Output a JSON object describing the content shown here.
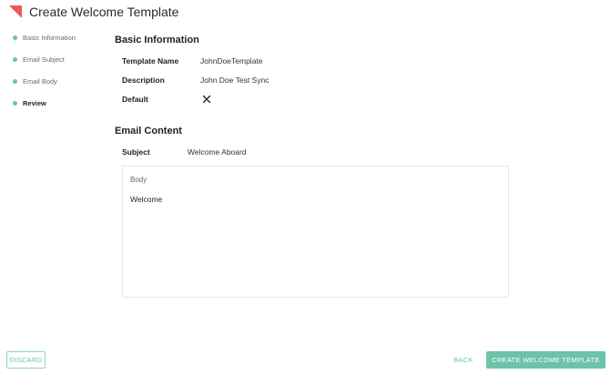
{
  "header": {
    "title": "Create Welcome Template",
    "logo_color": "#e8585e"
  },
  "stepper": {
    "items": [
      {
        "label": "Basic Information",
        "active": false
      },
      {
        "label": "Email Subject",
        "active": false
      },
      {
        "label": "Email Body",
        "active": false
      },
      {
        "label": "Review",
        "active": true
      }
    ],
    "dot_color": "#6cc3a9"
  },
  "basic_info": {
    "title": "Basic Information",
    "template_name_label": "Template Name",
    "template_name_value": "JohnDoeTemplate",
    "description_label": "Description",
    "description_value": "John Doe Test Sync",
    "default_label": "Default",
    "default_icon": "close-icon"
  },
  "email_content": {
    "title": "Email Content",
    "subject_label": "Subject",
    "subject_value": "Welcome Aboard",
    "body_label": "Body",
    "body_value": "Welcome"
  },
  "footer": {
    "discard_label": "DISCARD",
    "back_label": "BACK",
    "create_label": "CREATE WELCOME TEMPLATE",
    "accent_color": "#6cc3a9"
  }
}
